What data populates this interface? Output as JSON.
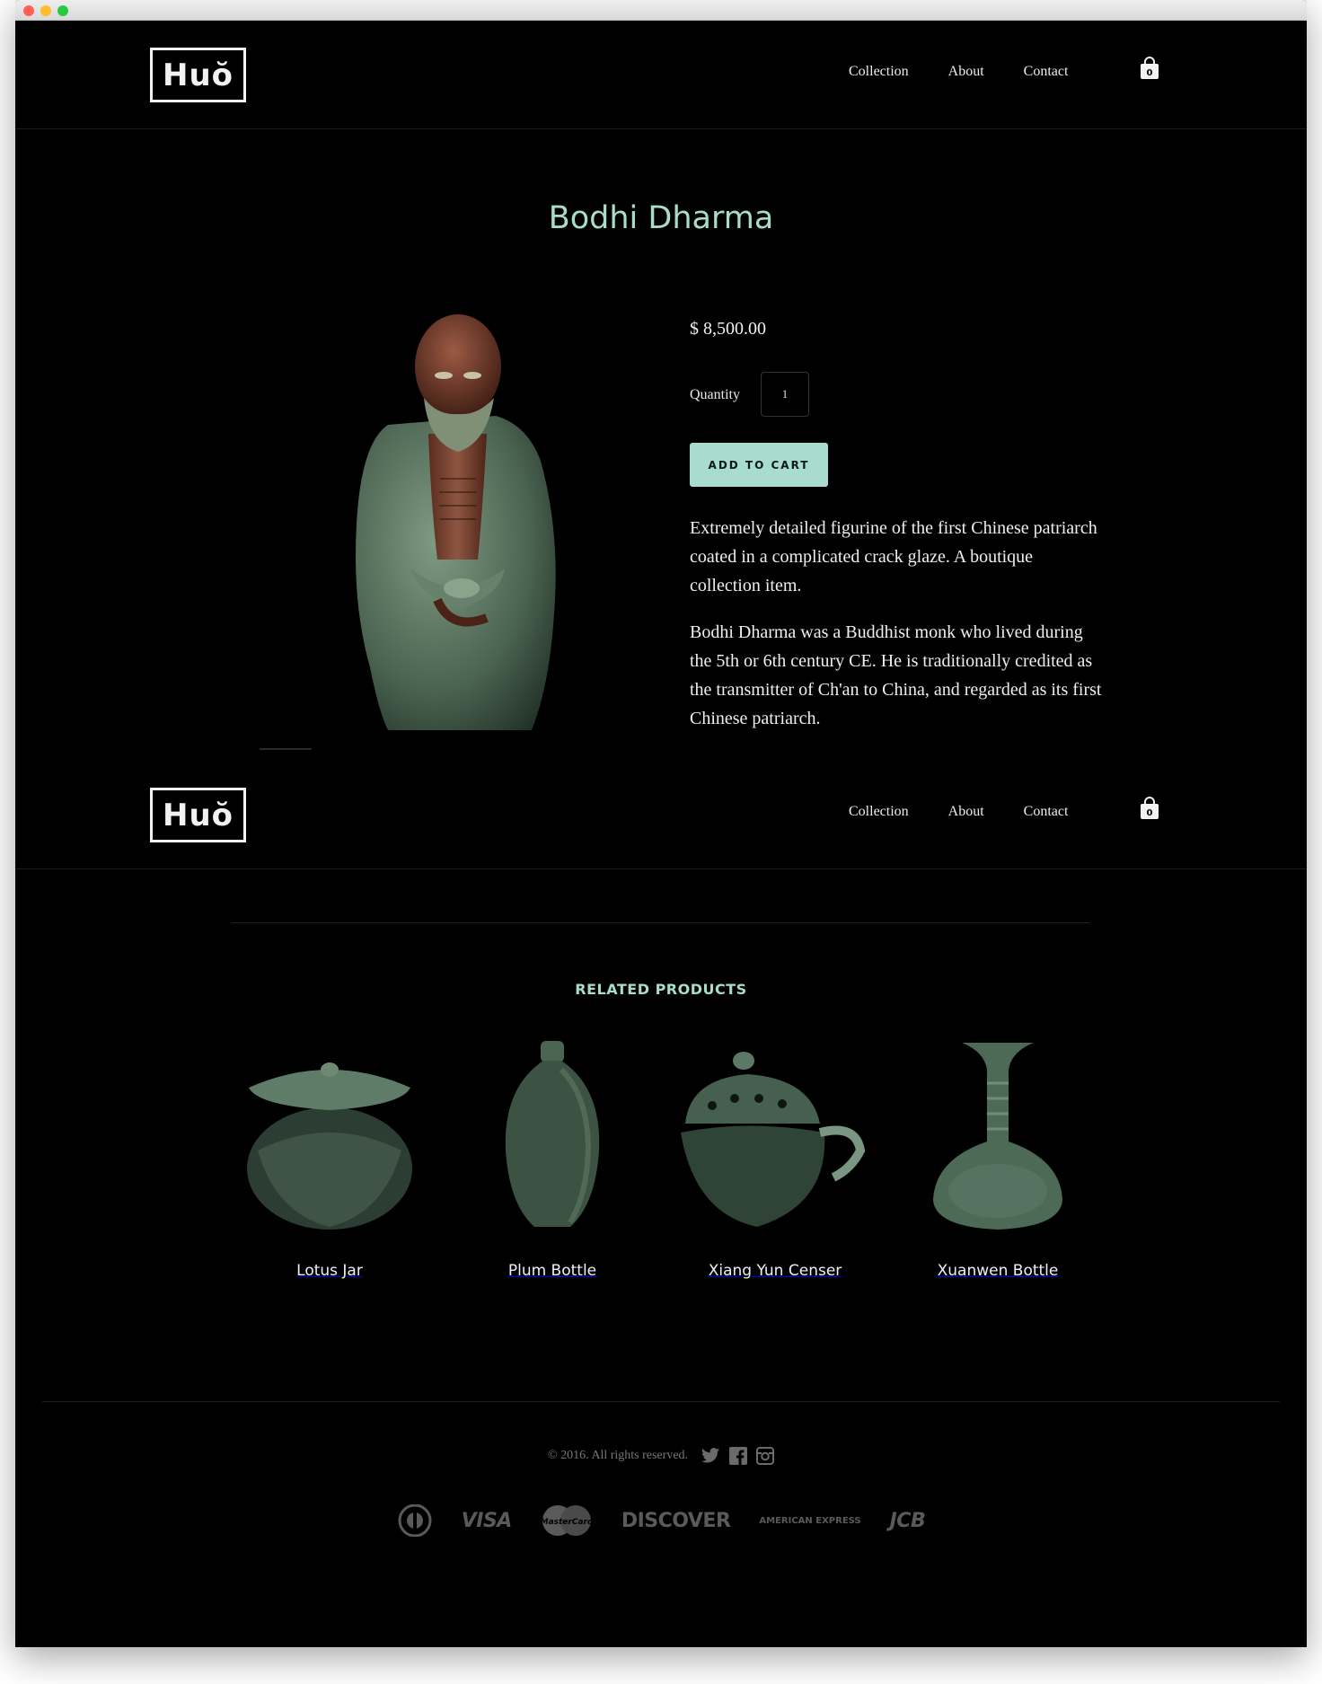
{
  "brand": {
    "logo_text": "Huŏ"
  },
  "nav": {
    "items": [
      "Collection",
      "About",
      "Contact"
    ],
    "cart_count": "0"
  },
  "product": {
    "title": "Bodhi Dharma",
    "price": "$ 8,500.00",
    "quantity_label": "Quantity",
    "quantity_value": "1",
    "add_to_cart_label": "ADD TO CART",
    "description": [
      "Extremely detailed figurine of the first Chinese patriarch coated in a complicated crack glaze. A boutique collection item.",
      "Bodhi Dharma was a Buddhist monk who lived during the 5th or 6th century CE. He is traditionally credited as the transmitter of Ch'an to China, and regarded as its first Chinese patriarch."
    ]
  },
  "related": {
    "title": "RELATED PRODUCTS",
    "items": [
      {
        "name": "Lotus Jar",
        "icon": "lotus-jar-image"
      },
      {
        "name": "Plum Bottle",
        "icon": "plum-bottle-image"
      },
      {
        "name": "Xiang Yun Censer",
        "icon": "censer-image"
      },
      {
        "name": "Xuanwen Bottle",
        "icon": "xuanwen-bottle-image"
      }
    ]
  },
  "footer": {
    "copyright": "© 2016. All rights reserved.",
    "social": [
      "twitter-icon",
      "facebook-icon",
      "instagram-icon"
    ],
    "payments": [
      "VISA",
      "DISCOVER",
      "JCB"
    ],
    "payment_marks": {
      "mastercard": "MasterCard",
      "amex": "AMERICAN EXPRESS"
    }
  },
  "colors": {
    "accent": "#a8dccf",
    "background": "#000000",
    "text": "#efefef",
    "muted": "#5a5a5a"
  }
}
